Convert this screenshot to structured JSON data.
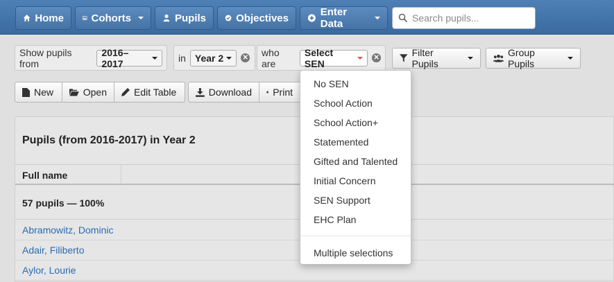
{
  "navbar": {
    "home": "Home",
    "cohorts": "Cohorts",
    "pupils": "Pupils",
    "objectives": "Objectives",
    "enter_data": "Enter Data",
    "search_placeholder": "Search pupils..."
  },
  "filters": {
    "show_from_label": "Show pupils from",
    "year_value": "2016–2017",
    "in_label": "in",
    "group_value": "Year 2",
    "who_are_label": "who are",
    "sen_value": "Select SEN",
    "filter_pupils": "Filter Pupils",
    "group_pupils": "Group Pupils"
  },
  "toolbar": {
    "new": "New",
    "open": "Open",
    "edit_table": "Edit Table",
    "download": "Download",
    "print": "Print"
  },
  "table": {
    "title": "Pupils (from 2016-2017) in Year 2",
    "column_full_name": "Full name",
    "summary": "57 pupils — 100%",
    "rows": [
      "Abramowitz, Dominic",
      "Adair, Filiberto",
      "Aylor, Lourie"
    ]
  },
  "sen_dropdown": {
    "items": [
      "No SEN",
      "School Action",
      "School Action+",
      "Statemented",
      "Gifted and Talented",
      "Initial Concern",
      "SEN Support",
      "EHC Plan"
    ],
    "multiple": "Multiple selections"
  },
  "colors": {
    "navbar": "#3f70a6",
    "link": "#2b6ab0",
    "caret_accent": "#d9534f"
  }
}
